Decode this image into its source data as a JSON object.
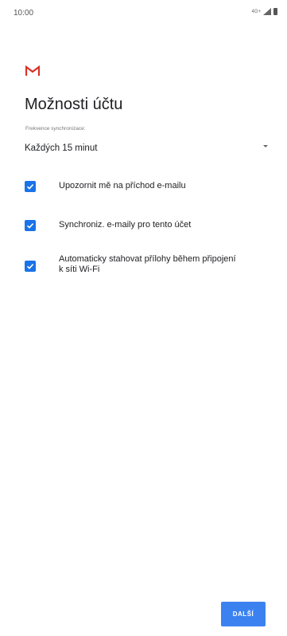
{
  "status_bar": {
    "time": "10:00",
    "network": "4G+"
  },
  "logo": {
    "icon": "gmail-icon",
    "color": "#d93025"
  },
  "page": {
    "title": "Možnosti účtu"
  },
  "sync": {
    "label": "Frekvence synchronizace:",
    "value": "Každých 15 minut"
  },
  "options": [
    {
      "label": "Upozornit mě na příchod e-mailu",
      "checked": true
    },
    {
      "label": "Synchroniz. e-maily pro tento účet",
      "checked": true
    },
    {
      "label": "Automaticky stahovat přílohy během připojení k síti Wi-Fi",
      "checked": true
    }
  ],
  "footer": {
    "next_label": "DALŠÍ"
  },
  "colors": {
    "accent": "#1a73e8",
    "button": "#3b82f0"
  }
}
